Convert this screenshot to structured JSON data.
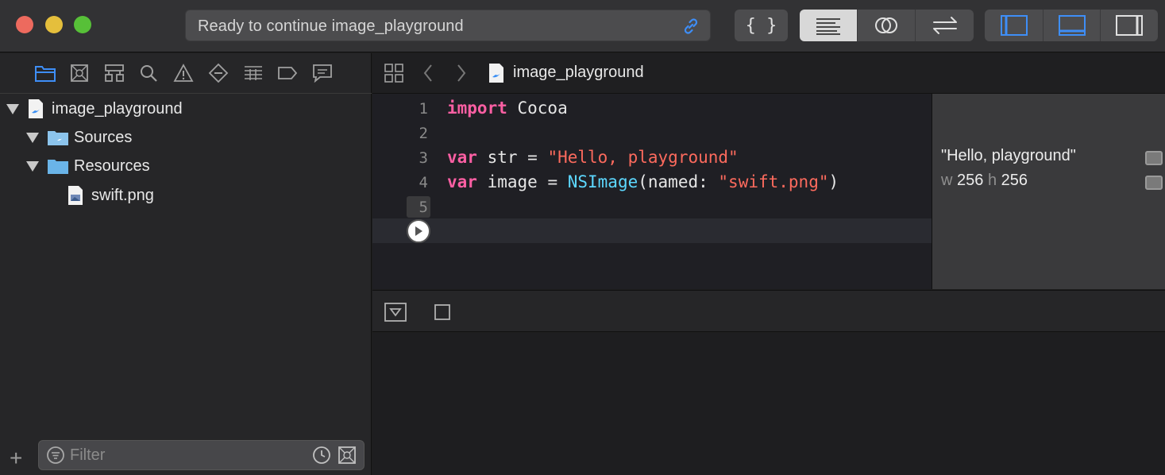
{
  "toolbar": {
    "status_text": "Ready to continue image_playground",
    "icons": [
      "link-icon",
      "library-braces-icon",
      "standard-editor-icon",
      "assistant-editor-icon",
      "version-editor-icon",
      "navigator-toggle-icon",
      "debug-area-toggle-icon",
      "inspector-toggle-icon"
    ],
    "accent": "#3e8ef7"
  },
  "navigator": {
    "tabs": [
      "project-navigator-icon",
      "source-control-icon",
      "symbol-navigator-icon",
      "find-icon",
      "issue-icon",
      "test-icon",
      "debug-icon",
      "breakpoint-icon",
      "report-icon"
    ],
    "tree": [
      {
        "label": "image_playground"
      },
      {
        "label": "Sources"
      },
      {
        "label": "Resources"
      },
      {
        "label": "swift.png"
      }
    ],
    "filter_placeholder": "Filter"
  },
  "editor": {
    "breadcrumb": "image_playground",
    "line_numbers": [
      "1",
      "2",
      "3",
      "4",
      "5"
    ],
    "code": {
      "l1_kw": "import",
      "l1_rest": " Cocoa",
      "l3_kw": "var",
      "l3_mid": " str = ",
      "l3_str": "\"Hello, playground\"",
      "l4_kw": "var",
      "l4_mid": " image = ",
      "l4_type": "NSImage",
      "l4_arg": "(named: ",
      "l4_str": "\"swift.png\"",
      "l4_end": ")"
    }
  },
  "results": {
    "r1": "\"Hello, playground\"",
    "r2_w": "w",
    "r2_wv": " 256 ",
    "r2_h": "h",
    "r2_hv": " 256"
  }
}
